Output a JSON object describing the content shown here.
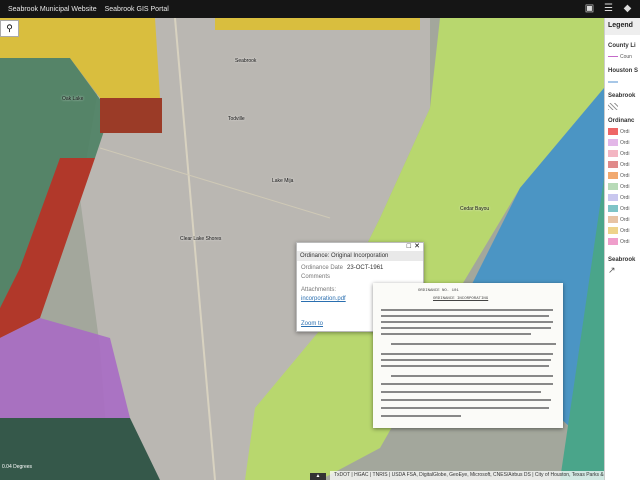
{
  "header": {
    "links": [
      "Seabrook Municipal Website",
      "Seabrook GIS Portal"
    ],
    "icons": [
      "details-icon",
      "legend-icon",
      "layers-icon"
    ]
  },
  "map": {
    "search_icon": "search-icon",
    "labels": [
      "Seabrook",
      "Todville",
      "Cedar Bayou",
      "Oak Lake",
      "Lake Mija",
      "Clear Lake Shores"
    ],
    "scale_text": "0.04 Degrees",
    "attribution": "TxDOT | HGAC | TNRIS | USDA FSA, DigitalGlobe, GeoEye, Microsoft, CNES/Airbus DS | City of Houston, Texas Parks & Wildlife"
  },
  "popup": {
    "title": "Ordinance: Original Incorporation",
    "date_label": "Ordinance Date",
    "date_value": "23-OCT-1961",
    "comments_label": "Comments",
    "attachments_label": "Attachments:",
    "attachment_link": "incorporation.pdf",
    "zoom_link": "Zoom to"
  },
  "document": {
    "ordinance_no": "ORDINANCE NO. 101",
    "heading": "ORDINANCE INCORPORATING"
  },
  "legend": {
    "title": "Legend",
    "county_limits": "County Li",
    "county_item": "Coun",
    "houston_ship": "Houston S",
    "seabrook_section": "Seabrook",
    "ordinance_section": "Ordinanc",
    "ordinance_items": [
      "Ordi",
      "Ordi",
      "Ordi",
      "Ordi",
      "Ordi",
      "Ordi",
      "Ordi",
      "Ordi",
      "Ordi",
      "Ordi",
      "Ordi"
    ],
    "bottom_section": "Seabrook",
    "colors": {
      "county_line": "#c46ac9",
      "ship": "#a7c7e7",
      "items": [
        "#e66",
        "#e3b7e8",
        "#f3b5c2",
        "#e08a8a",
        "#f1a970",
        "#b7dab7",
        "#c9c7ef",
        "#7ec4c7",
        "#e7c3a4",
        "#eed38a",
        "#ef9ecb"
      ]
    }
  }
}
